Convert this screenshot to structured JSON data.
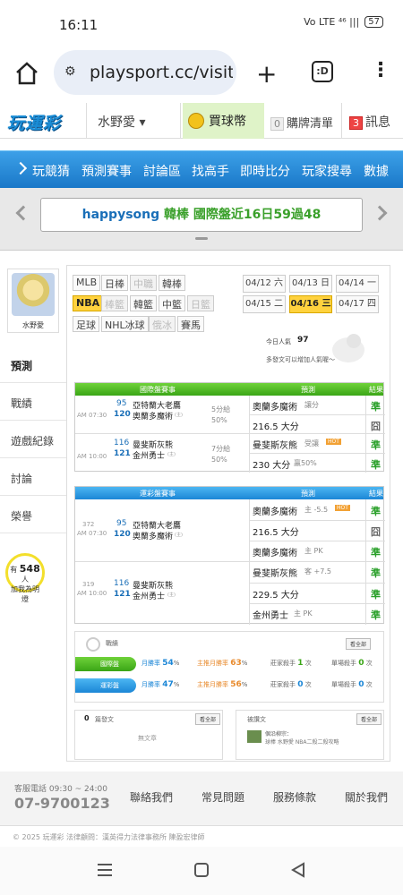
{
  "status_bar": {
    "time": "16:11",
    "icons": "Vo LTE ⁴⁶ ||| ",
    "battery": "57"
  },
  "browser": {
    "url": "playsport.cc/visit",
    "tab_count": ":D"
  },
  "topnav": {
    "logo": "玩運彩",
    "user": "水野愛 ▾",
    "buy": "買球幣",
    "cart_count": "0",
    "cart": "購牌清單",
    "msg_count": "3",
    "msg": "訊息"
  },
  "bluebar": {
    "items": [
      "玩競猜",
      "預測賽事",
      "討論區",
      "找高手",
      "即時比分",
      "玩家搜尋",
      "數據"
    ]
  },
  "ticker": {
    "user": "happysong",
    "text": "韓棒 國際盤近16日59過48"
  },
  "sidebar": {
    "avatar_name": "水野愛",
    "nav": [
      "預測",
      "戰績",
      "遊戲紀錄",
      "討論",
      "榮譽"
    ],
    "fans_prefix": "有",
    "fans_count": "548",
    "fans_suffix": "人",
    "fans_line2": "加我為明燈"
  },
  "filters": {
    "row1": [
      "MLB",
      "日棒",
      "中職",
      "韓棒"
    ],
    "row2": [
      "NBA",
      "棒籃",
      "韓籃",
      "中籃",
      "日籃"
    ],
    "row3": [
      "足球",
      "NHL冰球",
      "俄冰",
      "賽馬"
    ],
    "active": "NBA",
    "dates_row1": [
      "04/12 六",
      "04/13 日",
      "04/14 一"
    ],
    "dates_row2": [
      "04/15 二",
      "04/16 三",
      "04/17 四"
    ]
  },
  "popularity": {
    "label": "今日人氣",
    "value": "97",
    "note": "多發文可以增加人氣喔～"
  },
  "intl_table": {
    "headers": [
      "國際盤賽事",
      "預測",
      "結果"
    ],
    "games": [
      {
        "time": "AM 07:30",
        "away_no": "95",
        "away": "亞特蘭大老鷹",
        "home_no": "120",
        "home": "奧蘭多魔術",
        "home_tag": "(主)",
        "spread": "5分給",
        "pct": "50%",
        "picks": [
          {
            "text": "奧蘭多魔術",
            "note": "讓分",
            "result": "準"
          },
          {
            "text": "216.5 大分",
            "note": "",
            "result": "囧"
          }
        ]
      },
      {
        "time": "AM 10:00",
        "away_no": "116",
        "away": "曼斐斯灰熊",
        "home_no": "121",
        "home": "金州勇士",
        "home_tag": "(主)",
        "spread": "7分給",
        "pct": "50%",
        "picks": [
          {
            "text": "曼斐斯灰熊",
            "note": "受讓",
            "result": "準"
          },
          {
            "text": "230 大分",
            "note": "贏50%",
            "result": "準"
          }
        ]
      }
    ]
  },
  "sport_table": {
    "headers": [
      "運彩盤賽事",
      "預測",
      "結果"
    ],
    "games": [
      {
        "code": "372",
        "time": "AM 07:30",
        "away_no": "95",
        "away": "亞特蘭大老鷹",
        "home_no": "120",
        "home": "奧蘭多魔術",
        "home_tag": "(主)",
        "picks": [
          {
            "text": "奧蘭多魔術",
            "note": "主 -5.5",
            "result": "準"
          },
          {
            "text": "216.5 大分",
            "note": "",
            "result": "囧"
          },
          {
            "text": "奧蘭多魔術",
            "note": "主 PK",
            "result": "準"
          }
        ]
      },
      {
        "code": "319",
        "time": "AM 10:00",
        "away_no": "116",
        "away": "曼斐斯灰熊",
        "home_no": "121",
        "home": "金州勇士",
        "home_tag": "(主)",
        "picks": [
          {
            "text": "曼斐斯灰熊",
            "note": "客 +7.5",
            "result": "準"
          },
          {
            "text": "229.5 大分",
            "note": "",
            "result": "準"
          },
          {
            "text": "金州勇士",
            "note": "主 PK",
            "result": "準"
          }
        ]
      }
    ]
  },
  "stats": {
    "title": "戰績",
    "more": "看全部",
    "rows": [
      {
        "label": "國際盤",
        "c1": "月勝率",
        "v1": "54",
        "c2": "主推月勝率",
        "v2": "63",
        "c3": "莊家殺手",
        "v3": "1",
        "c4": "單場殺手",
        "v4": "0"
      },
      {
        "label": "運彩盤",
        "c1": "月勝率",
        "v1": "47",
        "c2": "主推月勝率",
        "v2": "56",
        "c3": "莊家殺手",
        "v3": "0",
        "c4": "單場殺手",
        "v4": "0"
      }
    ],
    "pct": "%",
    "unit": "次"
  },
  "bottom_boxes": {
    "left_count": "0",
    "left_title": "篇發文",
    "left_more": "看全部",
    "left_empty": "無文章",
    "right_title": "被讚文",
    "right_more": "看全部",
    "right_line1": "個沿柳宗：",
    "right_line2": "球棒 水野愛 NBA二殺二殺攻略"
  },
  "footer": {
    "service_label": "客服電話 09:30 ~ 24:00",
    "phone": "07-9700123",
    "links": [
      "聯絡我們",
      "常見問題",
      "服務條款",
      "關於我們"
    ],
    "copyright": "© 2025 玩運彩 法律顧問：漢英得力法律事務所 陳盈宏律師"
  },
  "colors": {
    "accent_blue": "#1a78c8",
    "green": "#3aa516",
    "yellow": "#ffd23e"
  }
}
